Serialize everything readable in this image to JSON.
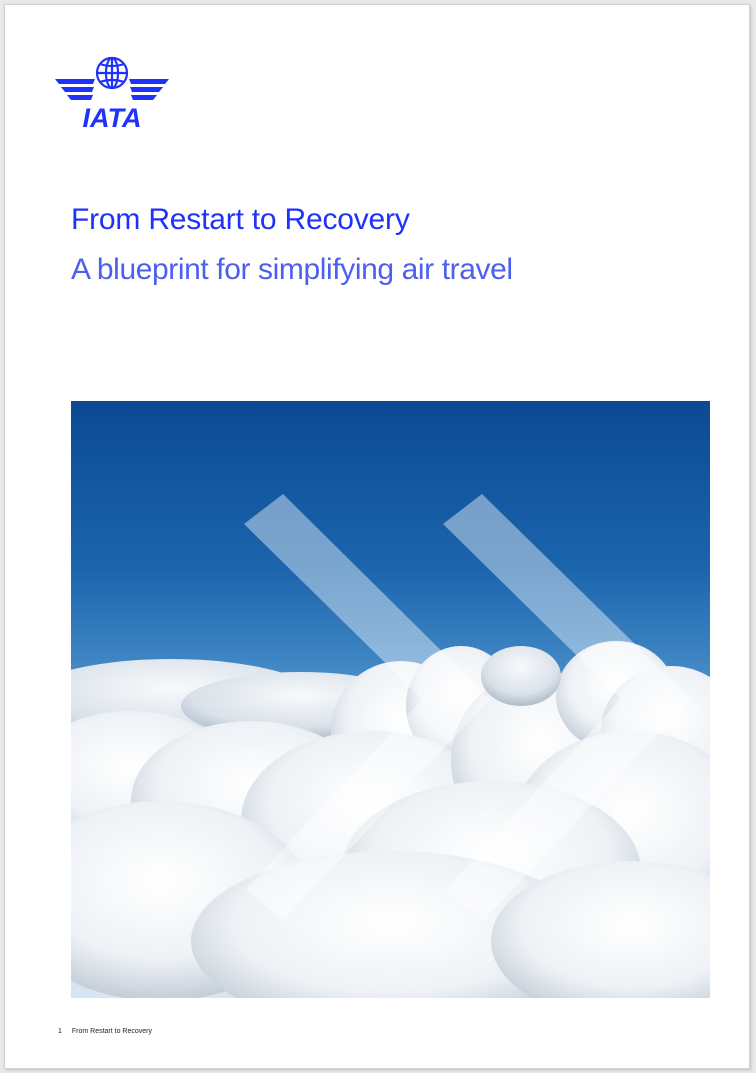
{
  "logo": {
    "text": "IATA"
  },
  "title": "From Restart to Recovery",
  "subtitle": "A blueprint for simplifying air travel",
  "footer": {
    "page_number": "1",
    "text": "From Restart to Recovery"
  },
  "colors": {
    "brand_blue": "#1e32fa",
    "subtitle_blue": "#4d5ff0",
    "sky_top": "#0b4c96",
    "sky_bottom": "#5aa0d4"
  }
}
